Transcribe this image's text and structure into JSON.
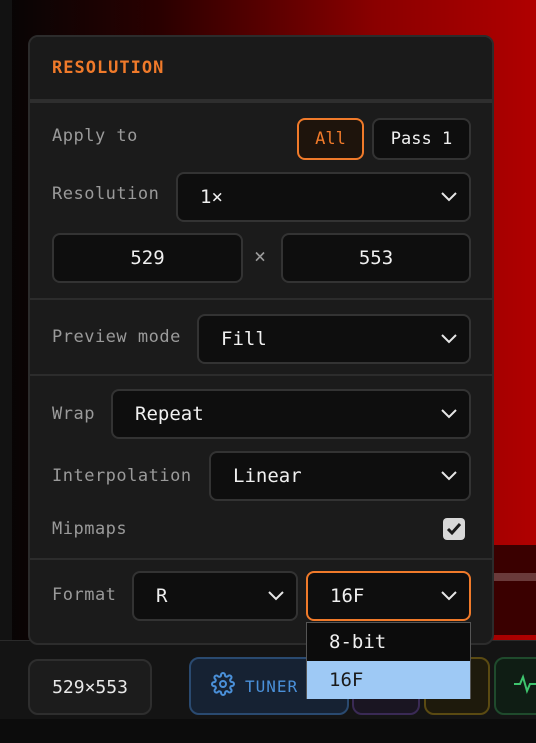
{
  "panel": {
    "title": "RESOLUTION",
    "apply_to": {
      "label": "Apply to",
      "options": [
        "All",
        "Pass 1"
      ],
      "selected": "All"
    },
    "resolution": {
      "label": "Resolution",
      "value": "1×",
      "width": "529",
      "times": "×",
      "height": "553"
    },
    "preview_mode": {
      "label": "Preview mode",
      "value": "Fill"
    },
    "wrap": {
      "label": "Wrap",
      "value": "Repeat"
    },
    "interpolation": {
      "label": "Interpolation",
      "value": "Linear"
    },
    "mipmaps": {
      "label": "Mipmaps",
      "checked": true
    },
    "format": {
      "label": "Format",
      "channels": "R",
      "depth": "16F"
    }
  },
  "format_dropdown": {
    "options": [
      "8-bit",
      "16F"
    ],
    "selected": "16F"
  },
  "bottom_bar": {
    "dimensions": "529×553",
    "tuner_label": "TUNER"
  },
  "colors": {
    "accent": "#f07a2a",
    "selection": "#9ec9f5",
    "tuner": "#4a90d9"
  }
}
